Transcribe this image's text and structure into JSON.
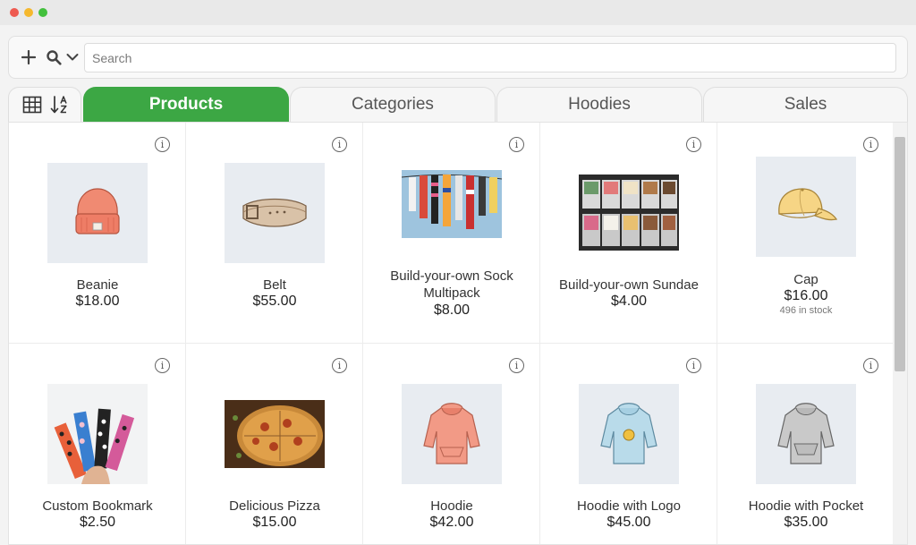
{
  "search": {
    "placeholder": "Search"
  },
  "toolbar": {
    "add_icon": "plus-icon",
    "search_icon": "magnifier-icon",
    "dropdown_icon": "chevron-down-icon",
    "grid_icon": "grid-view-icon",
    "sort_icon": "sort-a-z-icon"
  },
  "tabs": [
    {
      "label": "Products",
      "active": true
    },
    {
      "label": "Categories",
      "active": false
    },
    {
      "label": "Hoodies",
      "active": false
    },
    {
      "label": "Sales",
      "active": false
    }
  ],
  "products": [
    {
      "name": "Beanie",
      "price": "$18.00",
      "image": "beanie-image"
    },
    {
      "name": "Belt",
      "price": "$55.00",
      "image": "belt-image"
    },
    {
      "name": "Build-your-own Sock Multipack",
      "price": "$8.00",
      "image": "socks-photo"
    },
    {
      "name": "Build-your-own Sundae",
      "price": "$4.00",
      "image": "ice-cream-photo"
    },
    {
      "name": "Cap",
      "price": "$16.00",
      "stock": "496 in stock",
      "image": "cap-image"
    },
    {
      "name": "Custom Bookmark",
      "price": "$2.50",
      "image": "bookmarks-photo"
    },
    {
      "name": "Delicious Pizza",
      "price": "$15.00",
      "image": "pizza-photo"
    },
    {
      "name": "Hoodie",
      "price": "$42.00",
      "image": "hoodie-image"
    },
    {
      "name": "Hoodie with Logo",
      "price": "$45.00",
      "image": "hoodie-logo-image"
    },
    {
      "name": "Hoodie with Pocket",
      "price": "$35.00",
      "image": "hoodie-pocket-image"
    }
  ],
  "colors": {
    "accent": "#3ca744",
    "window_traffic_red": "#ee5a50",
    "window_traffic_yellow": "#f5b82d",
    "window_traffic_green": "#43c03d"
  }
}
